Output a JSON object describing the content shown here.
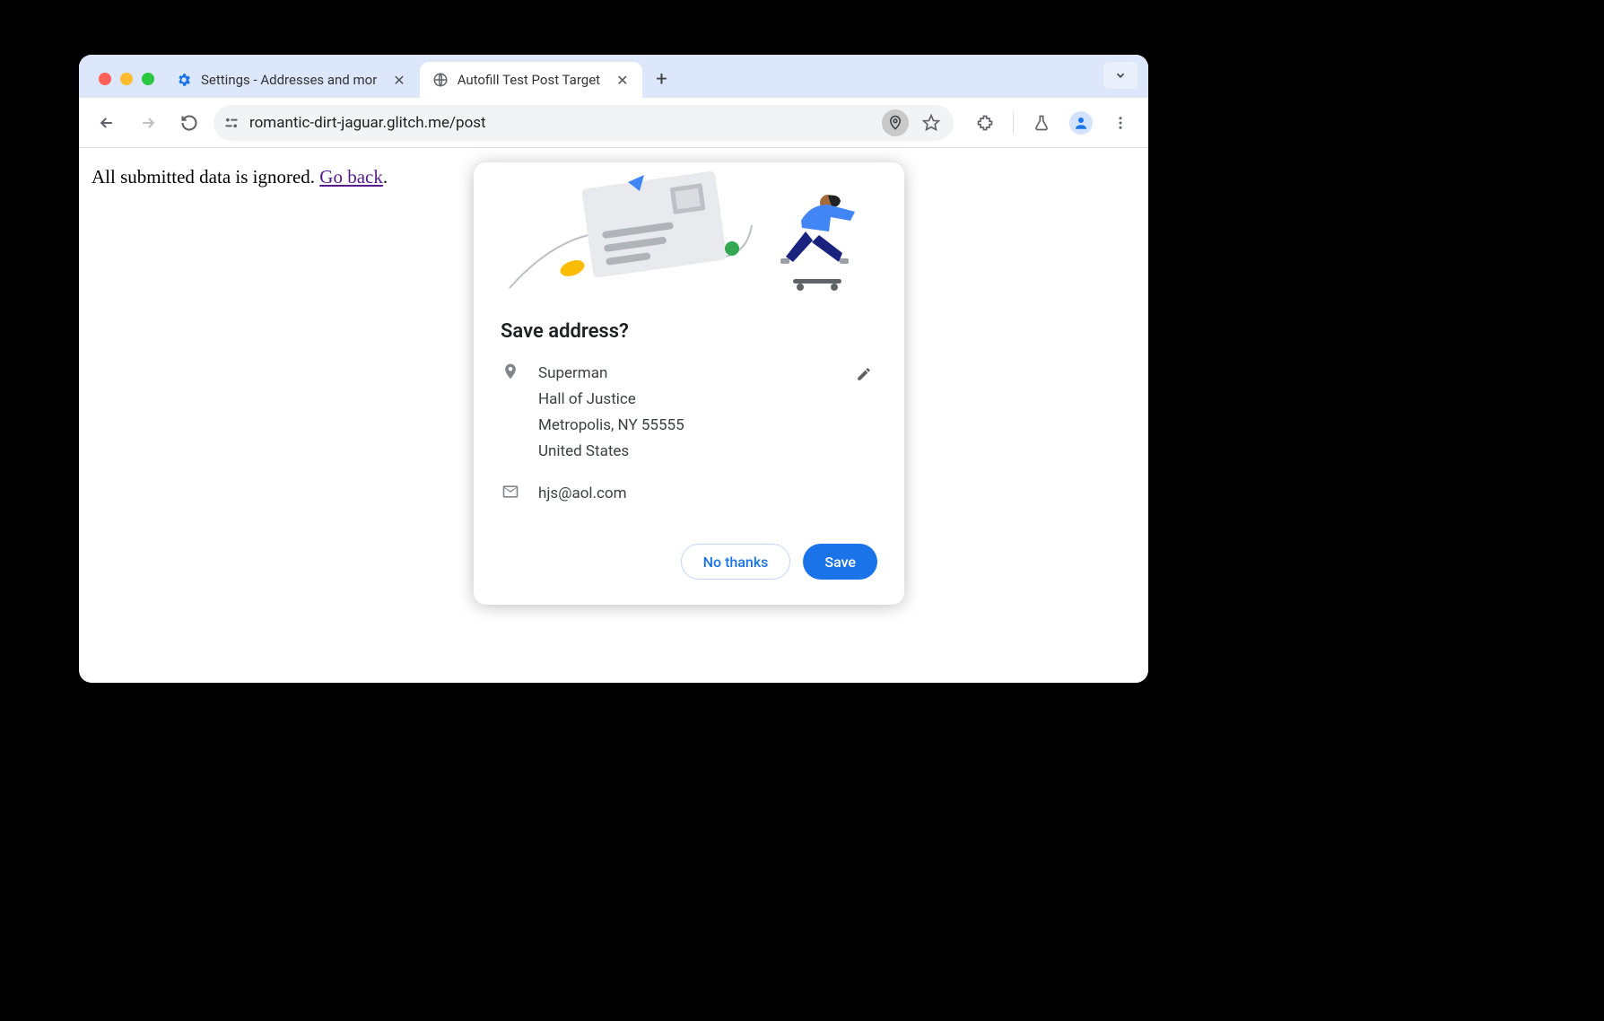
{
  "tabs": [
    {
      "title": "Settings - Addresses and mor",
      "icon": "settings-gear"
    },
    {
      "title": "Autofill Test Post Target",
      "icon": "globe"
    }
  ],
  "omnibox": {
    "url": "romantic-dirt-jaguar.glitch.me/post"
  },
  "page": {
    "body_text": "All submitted data is ignored. ",
    "link_text": "Go back",
    "trailing": "."
  },
  "dialog": {
    "title": "Save address?",
    "address": {
      "name": "Superman",
      "line1": "Hall of Justice",
      "line2": "Metropolis, NY 55555",
      "country": "United States"
    },
    "email": "hjs@aol.com",
    "no_thanks_label": "No thanks",
    "save_label": "Save"
  }
}
